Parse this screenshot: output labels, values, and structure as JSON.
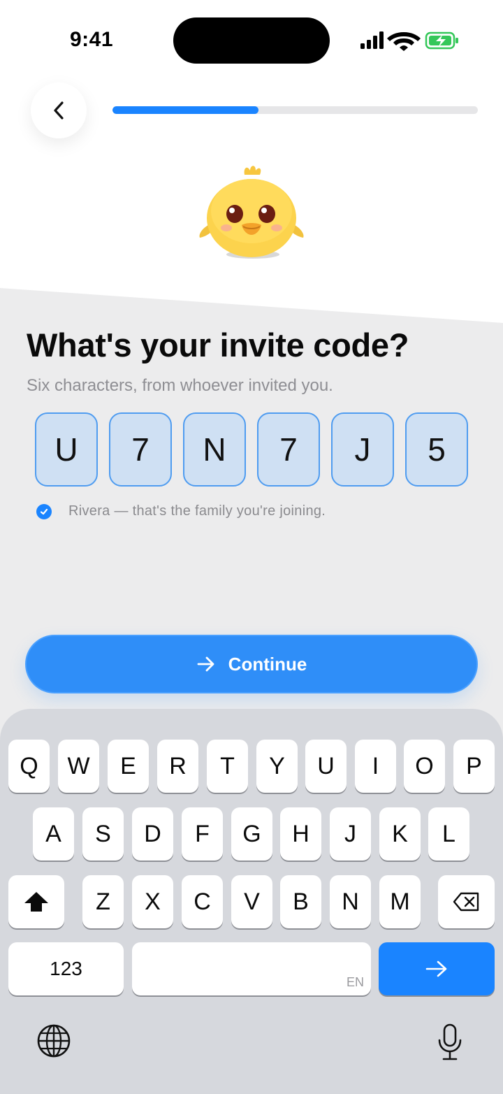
{
  "status_bar": {
    "time": "9:41"
  },
  "header": {
    "back_icon": "chevron-left-icon",
    "progress_fraction": 0.4
  },
  "mascot": {
    "icon": "chick-mascot"
  },
  "main": {
    "title": "What's your invite code?",
    "subtitle": "Six characters, from whoever invited you.",
    "code": [
      "U",
      "7",
      "N",
      "7",
      "J",
      "5"
    ],
    "confirmation": "Rivera — that's the family you're joining.",
    "continue_label": "Continue"
  },
  "keyboard": {
    "row1": [
      "Q",
      "W",
      "E",
      "R",
      "T",
      "Y",
      "U",
      "I",
      "O",
      "P"
    ],
    "row2": [
      "A",
      "S",
      "D",
      "F",
      "G",
      "H",
      "J",
      "K",
      "L"
    ],
    "row3": [
      "Z",
      "X",
      "C",
      "V",
      "B",
      "N",
      "M"
    ],
    "numbers_label": "123",
    "space_lang": "EN"
  },
  "colors": {
    "accent": "#1a84ff",
    "code_box_fill": "#cfe0f3",
    "background_grey": "#ececed"
  }
}
